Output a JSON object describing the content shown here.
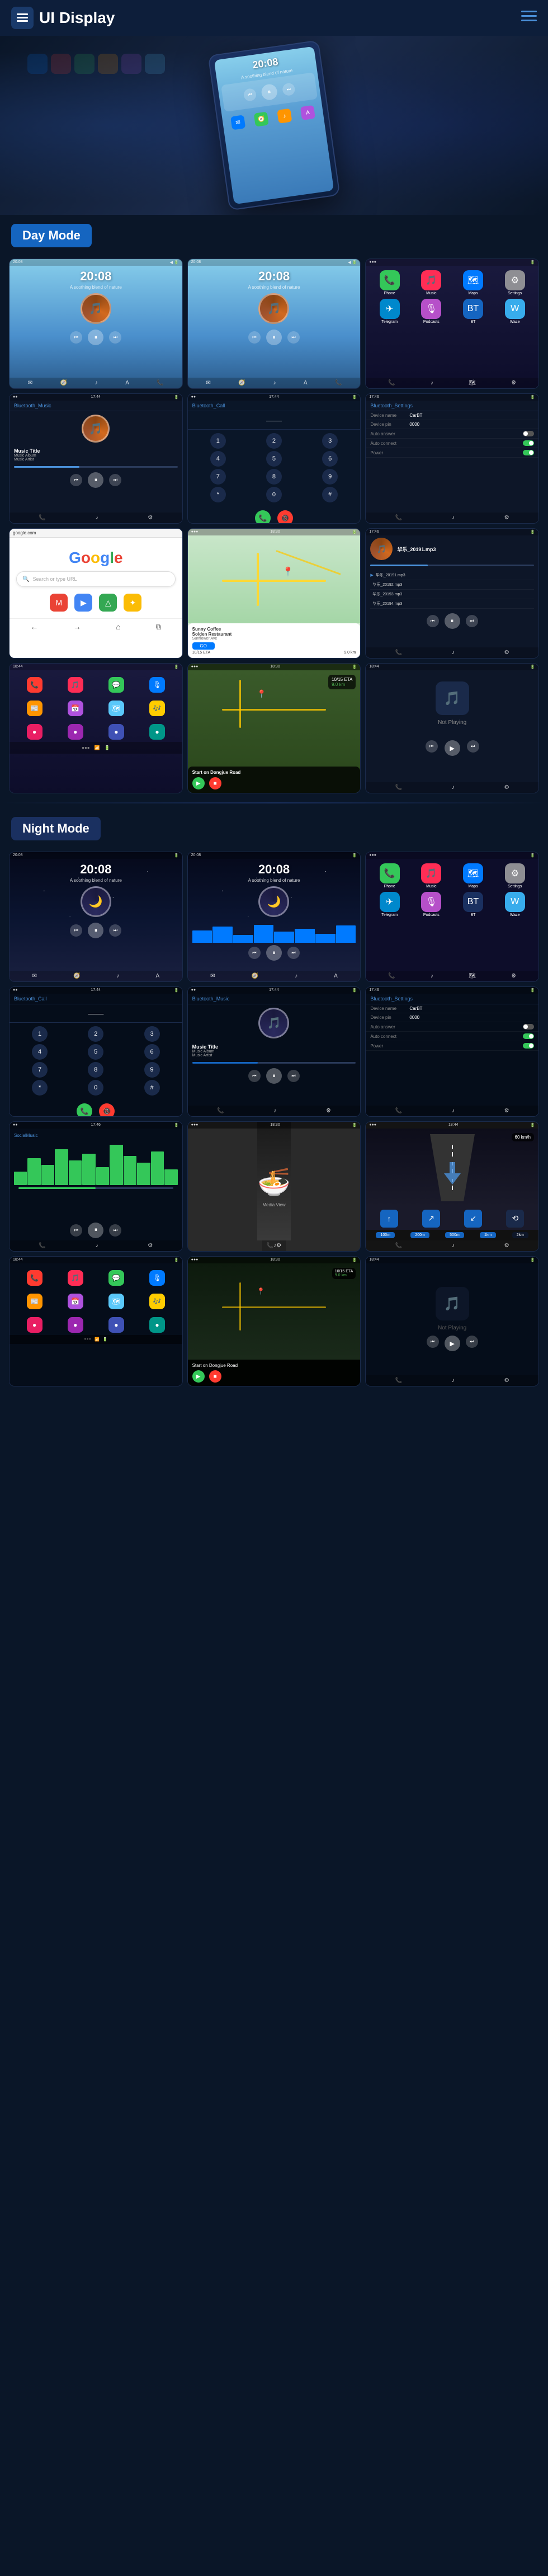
{
  "header": {
    "title": "UI Display",
    "logo_icon": "☰",
    "menu_icon": "≡"
  },
  "sections": {
    "day_mode": "Day Mode",
    "night_mode": "Night Mode"
  },
  "hero": {
    "device_time": "20:08",
    "device_subtitle": "A soothing blend of nature"
  },
  "day_screenshots": [
    {
      "id": "day-music-1",
      "type": "music",
      "time": "20:08",
      "subtitle": "A soothing blend of nature"
    },
    {
      "id": "day-music-2",
      "type": "music",
      "time": "20:08",
      "subtitle": "A soothing blend of nature"
    },
    {
      "id": "day-carplay",
      "type": "carplay_apps",
      "time": ""
    },
    {
      "id": "day-bt-music",
      "type": "bt_music",
      "title": "Bluetooth_Music",
      "track": "Music Title",
      "album": "Music Album",
      "artist": "Music Artist"
    },
    {
      "id": "day-phone",
      "type": "phone",
      "title": "Bluetooth_Call"
    },
    {
      "id": "day-bt-settings",
      "type": "bt_settings",
      "title": "Bluetooth_Settings",
      "device_name": "CarBT",
      "device_pin": "0000"
    },
    {
      "id": "day-google",
      "type": "google"
    },
    {
      "id": "day-map",
      "type": "map_navigation",
      "destination": "Sunny Coffee\nSolden Restaurant",
      "address": "1234 Sunflower Ave"
    },
    {
      "id": "day-now-playing",
      "type": "now_playing",
      "tracks": [
        "华乐_20191.mp3",
        "华乐_20192.mp3",
        "华乐_20193.mp3"
      ]
    },
    {
      "id": "day-carplay2",
      "type": "carplay_home"
    },
    {
      "id": "day-waze",
      "type": "waze_map",
      "eta": "10/15 ETA",
      "distance": "9.0 km"
    },
    {
      "id": "day-not-playing",
      "type": "not_playing",
      "label": "Not Playing"
    }
  ],
  "night_screenshots": [
    {
      "id": "night-music-1",
      "type": "night_music",
      "time": "20:08"
    },
    {
      "id": "night-music-2",
      "type": "night_music",
      "time": "20:08"
    },
    {
      "id": "night-carplay",
      "type": "night_carplay"
    },
    {
      "id": "night-phone",
      "type": "night_phone",
      "title": "Bluetooth_Call"
    },
    {
      "id": "night-bt-music",
      "type": "night_bt_music",
      "title": "Bluetooth_Music",
      "track": "Music Title",
      "album": "Music Album",
      "artist": "Music Artist"
    },
    {
      "id": "night-bt-settings",
      "type": "night_bt_settings",
      "title": "Bluetooth_Settings"
    },
    {
      "id": "night-waveform",
      "type": "night_waveform"
    },
    {
      "id": "night-food",
      "type": "night_food"
    },
    {
      "id": "night-road",
      "type": "night_road"
    },
    {
      "id": "night-carplay2",
      "type": "night_carplay_home"
    },
    {
      "id": "night-waze",
      "type": "night_waze",
      "eta": "10/15 ETA"
    },
    {
      "id": "night-not-playing",
      "type": "night_not_playing",
      "label": "Not Playing"
    }
  ],
  "app_icons": {
    "phone": "📞",
    "maps": "🗺",
    "music": "🎵",
    "messages": "💬",
    "settings": "⚙️",
    "podcasts": "🎙",
    "calendar": "📅",
    "news": "📰"
  },
  "bt_settings": {
    "device_name_label": "Device name",
    "device_name_value": "CarBT",
    "device_pin_label": "Device pin",
    "device_pin_value": "0000",
    "auto_answer_label": "Auto answer",
    "auto_connect_label": "Auto connect",
    "power_label": "Power"
  },
  "google": {
    "search_placeholder": "Search or type URL"
  },
  "music_screen": {
    "track_title": "Music Title",
    "album": "Music Album",
    "artist": "Music Artist",
    "time_label": "20:08"
  },
  "now_playing": {
    "tracks": [
      "华乐_20191.mp3",
      "华乐_20192.mp3",
      "华乐_20193.mp3",
      "华乐_20194.mp3"
    ]
  },
  "waze": {
    "eta_label": "10/15 ETA",
    "distance_label": "9.0 km",
    "destination": "Start on\nDongjue Road"
  },
  "sunny_coffee": {
    "name": "Sunny Coffee Solden Restaurant",
    "address": "1234 Sunflower Ave",
    "go_label": "GO",
    "eta": "10/15 ETA",
    "distance": "9.0 km"
  }
}
